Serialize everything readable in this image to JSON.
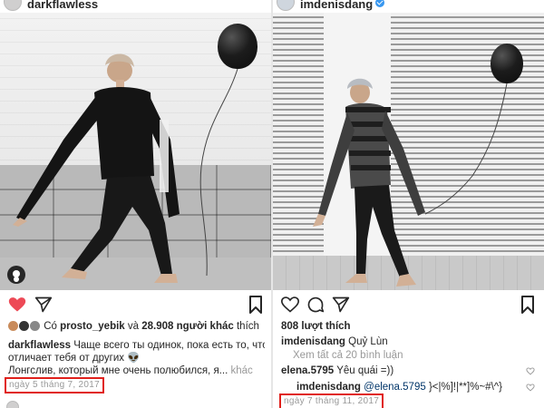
{
  "left_post": {
    "username": "darkflawless",
    "likes_prefix": "Có",
    "liker": "prosto_yebik",
    "likes_mid": "và",
    "likes_count": "28.908 người khác",
    "likes_suffix": "thích",
    "caption_user": "darkflawless",
    "caption_line1": "Чаще всего ты одинок, пока есть то, что",
    "caption_line2": "отличает тебя от других 👽",
    "caption_line3": "Лонгслив, который мне очень полюбился, я...",
    "more_label": "khác",
    "date": "ngày 5 tháng 7, 2017"
  },
  "right_post": {
    "username": "imdenisdang",
    "likes": "808 lượt thích",
    "caption_user": "imdenisdang",
    "caption_text": "Quỷ Lùn",
    "view_comments": "Xem tất cả 20 bình luận",
    "comments": [
      {
        "user": "elena.5795",
        "text": "Yêu quái =))"
      },
      {
        "user": "imdenisdang",
        "mention": "@elena.5795",
        "text": "}<|%]!|**]%~#\\^}"
      }
    ],
    "date": "ngày 7 tháng 11, 2017"
  },
  "icons": {
    "like_left": "heart-filled-icon",
    "comment": "comment-bubble-icon",
    "share": "paper-plane-icon",
    "save": "bookmark-icon",
    "like_right": "heart-outline-icon",
    "comment_like": "small-heart-icon",
    "verified": "verified-badge-icon",
    "shopping": "shopping-bag-icon"
  },
  "colors": {
    "like_red": "#ed4956",
    "highlight_box": "#e0201b",
    "verified_blue": "#3897f0",
    "muted_text": "#999999"
  }
}
